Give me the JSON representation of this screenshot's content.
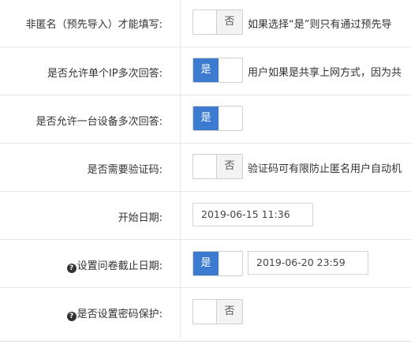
{
  "rows": [
    {
      "label": "非匿名（预先导入）才能填写:",
      "toggle": "否",
      "hint": "如果选择“是”则只有通过预先导"
    },
    {
      "label": "是否允许单个IP多次回答:",
      "toggle": "是",
      "hint": "用户如果是共享上网方式，因为共"
    },
    {
      "label": "是否允许一台设备多次回答:",
      "toggle": "是"
    },
    {
      "label": "是否需要验证码:",
      "toggle": "否",
      "hint": "验证码可有限防止匿名用户自动机"
    },
    {
      "label": "开始日期:",
      "date": "2019-06-15 11:36"
    },
    {
      "label": "设置问卷截止日期:",
      "toggle": "是",
      "date": "2019-06-20 23:59"
    },
    {
      "label": "是否设置密码保护:",
      "toggle": "否"
    }
  ],
  "colors": {
    "toggle_on": "#3c7bd0",
    "toggle_off_bg": "#f3f3f3",
    "border": "#cfcfcf"
  },
  "icons": {
    "help": "question-circle-icon"
  }
}
